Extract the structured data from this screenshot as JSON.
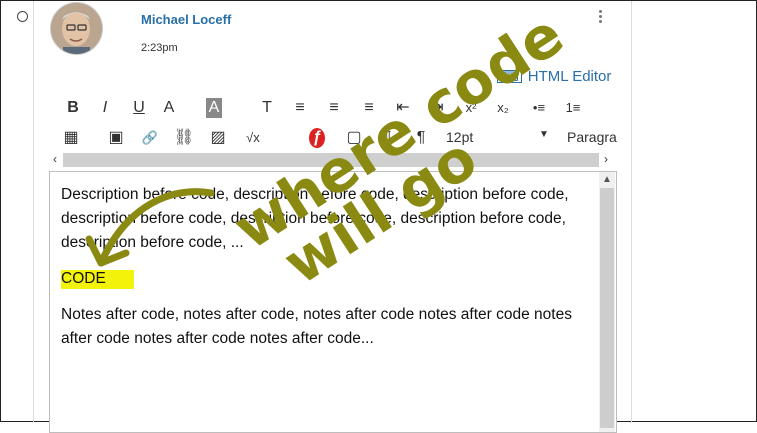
{
  "post": {
    "author": "Michael Loceff",
    "time": "2:23pm"
  },
  "editor": {
    "html_editor_label": "HTML Editor",
    "toolbar_row1": [
      {
        "name": "bold-icon",
        "glyph": "B"
      },
      {
        "name": "italic-icon",
        "glyph": "I"
      },
      {
        "name": "underline-icon",
        "glyph": "U"
      },
      {
        "name": "text-color-icon",
        "glyph": "A"
      },
      {
        "name": "background-color-icon",
        "glyph": "A"
      },
      {
        "name": "clear-formatting-icon",
        "glyph": "T"
      },
      {
        "name": "align-left-icon",
        "glyph": "≡"
      },
      {
        "name": "align-center-icon",
        "glyph": "≡"
      },
      {
        "name": "align-right-icon",
        "glyph": "≡"
      },
      {
        "name": "outdent-icon",
        "glyph": "⇤"
      },
      {
        "name": "indent-icon",
        "glyph": "⇥"
      },
      {
        "name": "superscript-icon",
        "glyph": "x²"
      },
      {
        "name": "subscript-icon",
        "glyph": "x₂"
      },
      {
        "name": "bullet-list-icon",
        "glyph": "•≡"
      },
      {
        "name": "numbered-list-icon",
        "glyph": "1≡"
      }
    ],
    "toolbar_row2": [
      {
        "name": "table-icon",
        "glyph": "▦"
      },
      {
        "name": "media-icon",
        "glyph": "▣"
      },
      {
        "name": "link-icon",
        "glyph": "🔗"
      },
      {
        "name": "unlink-icon",
        "glyph": "⛓"
      },
      {
        "name": "image-icon",
        "glyph": "▨"
      },
      {
        "name": "math-icon",
        "glyph": "√x"
      },
      {
        "name": "flash-icon",
        "glyph": "ƒ"
      },
      {
        "name": "embed-icon",
        "glyph": "▢"
      },
      {
        "name": "ltr-icon",
        "glyph": "¶"
      },
      {
        "name": "rtl-icon",
        "glyph": "¶"
      }
    ],
    "font_size": "12pt",
    "paragraph_label": "Paragra",
    "paragraph_1": "Description before code, description before code, description before code, description before code, description before code, description before code, description before code, ...",
    "code_placeholder": "CODE",
    "paragraph_2": "Notes after code, notes after code, notes after code notes after code notes after code notes after code notes after code..."
  },
  "annotation": {
    "word_1": "where code",
    "word_2": "will go",
    "color": "#8a8a12"
  }
}
